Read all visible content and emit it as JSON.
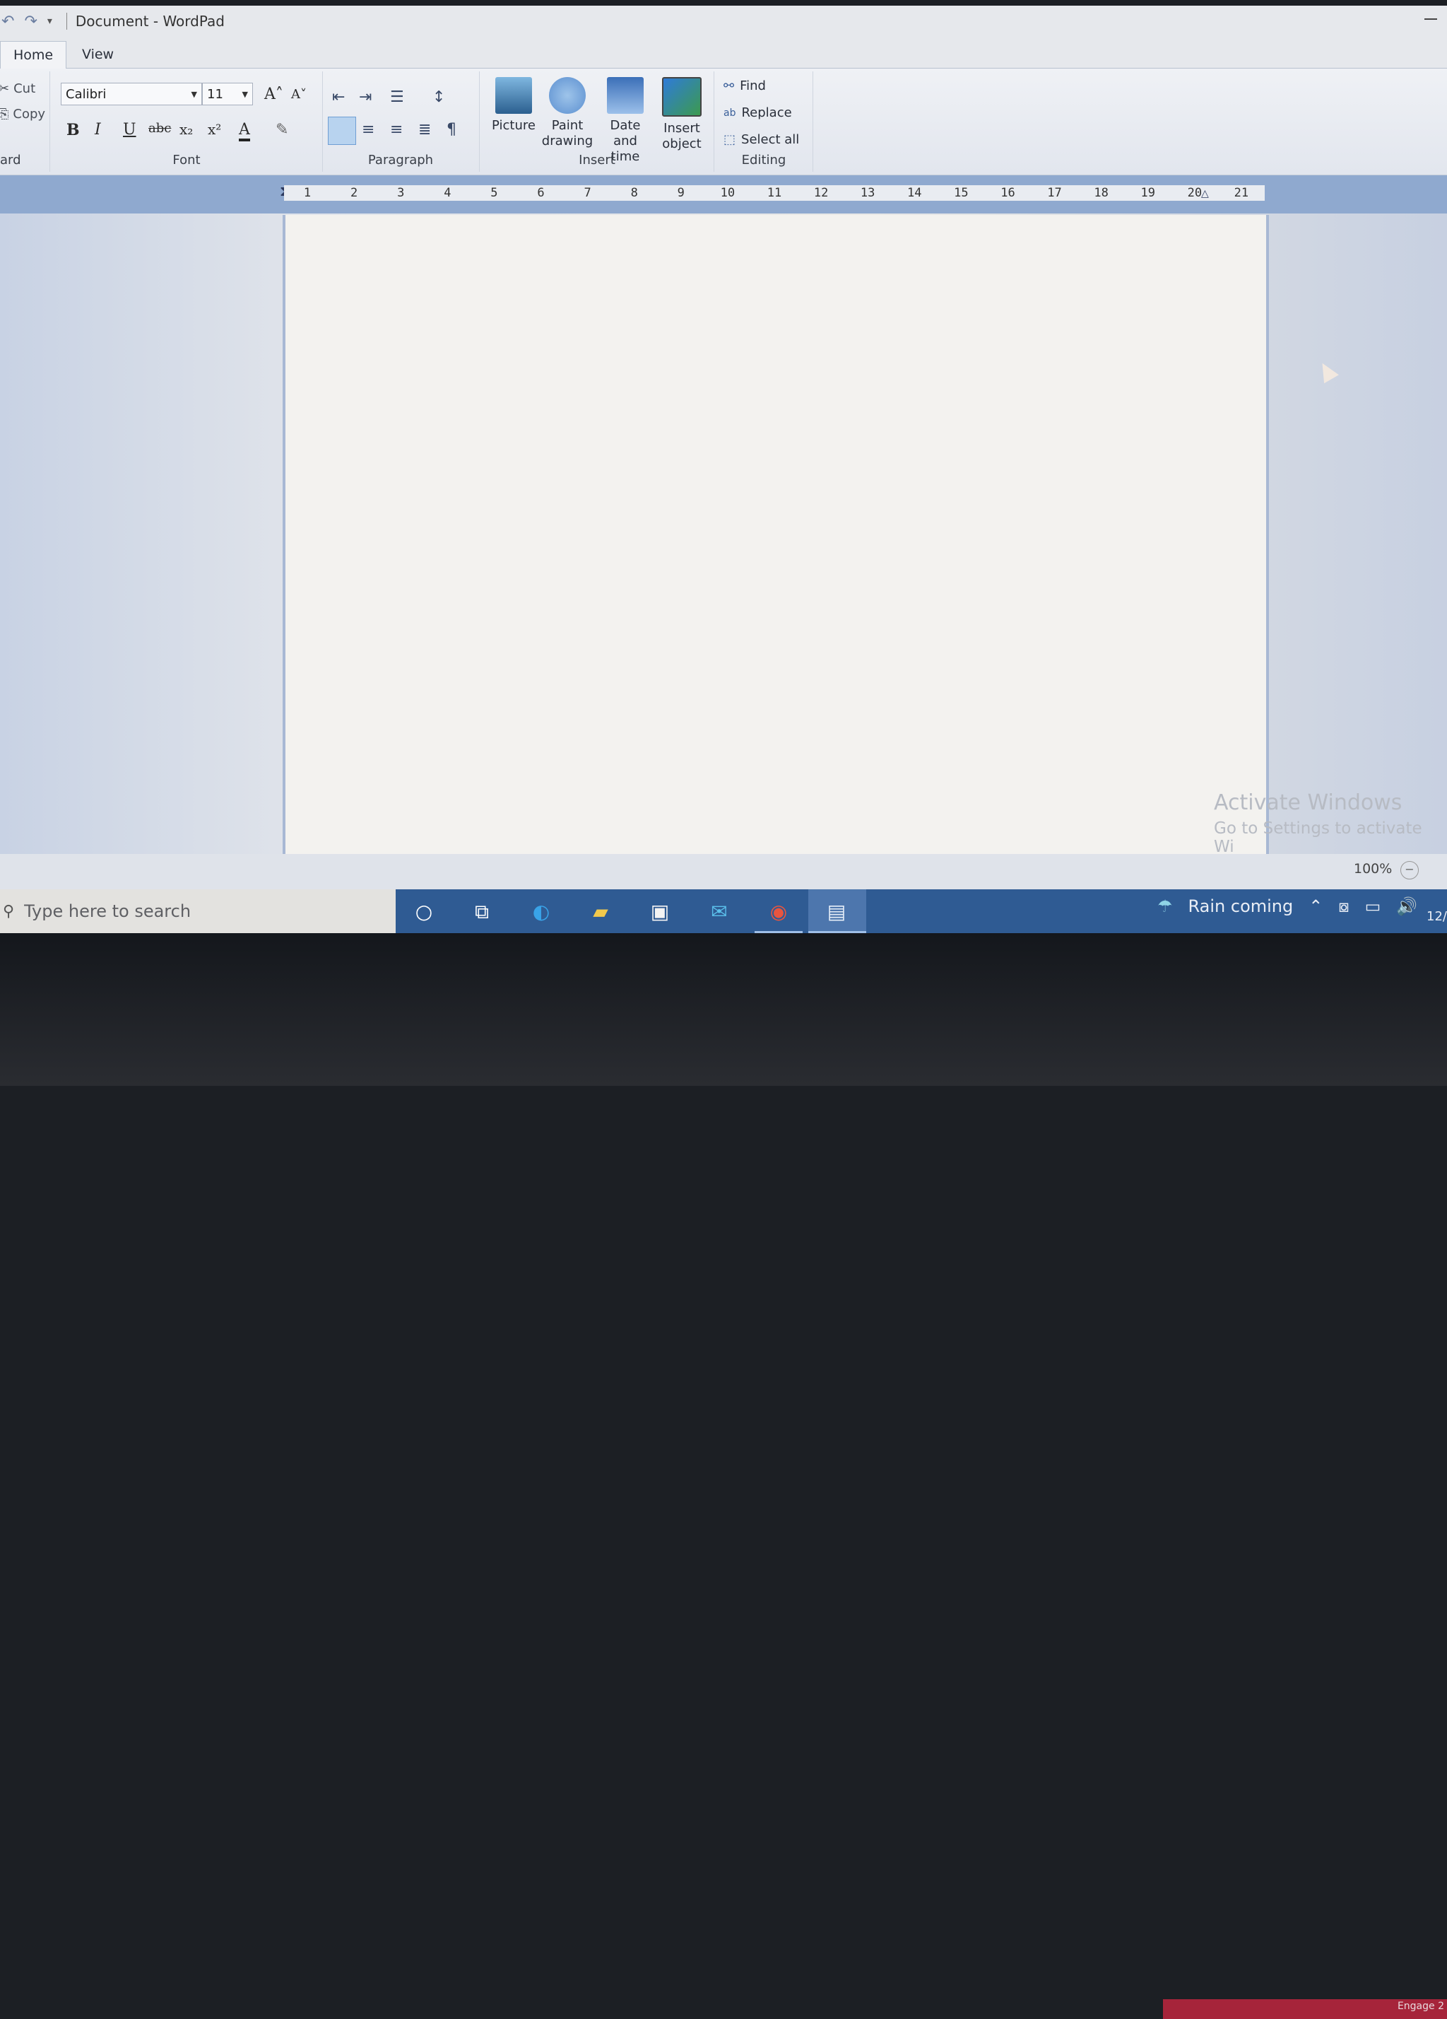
{
  "window": {
    "title": "Document - WordPad"
  },
  "tabs": [
    {
      "label": "Home"
    },
    {
      "label": "View"
    }
  ],
  "clipboard": {
    "cut": "Cut",
    "copy": "Copy",
    "label": "ard"
  },
  "font": {
    "family": "Calibri",
    "size": "11",
    "label": "Font",
    "bold": "B",
    "italic": "I",
    "underline": "U",
    "strike": "abc",
    "subscript": "x₂",
    "superscript": "x²",
    "color": "A",
    "grow": "A˄",
    "shrink": "A˅"
  },
  "paragraph": {
    "label": "Paragraph"
  },
  "insert": {
    "label": "Insert",
    "buttons": [
      {
        "label": "Picture"
      },
      {
        "label": "Paint drawing"
      },
      {
        "label": "Date and time"
      },
      {
        "label": "Insert object"
      }
    ]
  },
  "editing": {
    "label": "Editing",
    "find": "Find",
    "replace": "Replace",
    "select_all": "Select all"
  },
  "ruler": {
    "ticks": [
      "1",
      "2",
      "3",
      "4",
      "5",
      "6",
      "7",
      "8",
      "9",
      "10",
      "11",
      "12",
      "13",
      "14",
      "15",
      "16",
      "17",
      "18",
      "19",
      "20",
      "21"
    ]
  },
  "watermark": {
    "line1": "Activate Windows",
    "line2": "Go to Settings to activate Wi"
  },
  "status": {
    "zoom": "100%"
  },
  "taskbar": {
    "search_placeholder": "Type here to search",
    "weather": "Rain coming",
    "clock": "12/"
  },
  "bezel": {
    "sticker": "Engage 2"
  }
}
